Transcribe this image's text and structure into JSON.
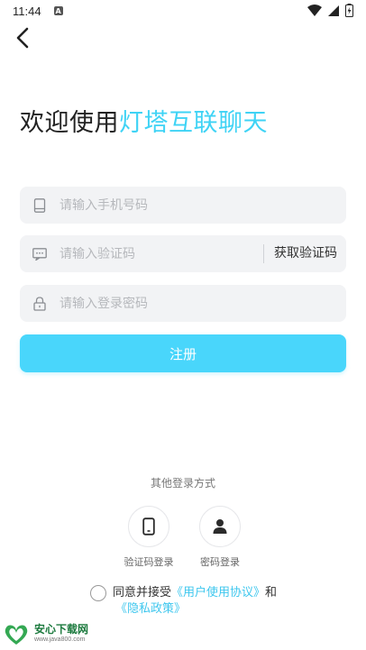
{
  "status_bar": {
    "time": "11:44",
    "notification_badge": "A"
  },
  "header": {
    "back_icon": "chevron-left-icon"
  },
  "welcome": {
    "prefix": "欢迎使用",
    "app_name": "灯塔互联聊天",
    "accent_color": "#3fd3f5"
  },
  "form": {
    "phone": {
      "placeholder": "请输入手机号码",
      "icon": "phone-icon"
    },
    "code": {
      "placeholder": "请输入验证码",
      "icon": "message-icon",
      "button_label": "获取验证码"
    },
    "password": {
      "placeholder": "请输入登录密码",
      "icon": "lock-icon"
    },
    "submit_label": "注册",
    "submit_color": "#49d6fb"
  },
  "other_login": {
    "title": "其他登录方式",
    "methods": [
      {
        "label": "验证码登录",
        "icon": "mobile-icon"
      },
      {
        "label": "密码登录",
        "icon": "user-icon"
      }
    ]
  },
  "agreement": {
    "prefix": "同意并接受",
    "user_agreement": "《用户使用协议》",
    "and": "和",
    "privacy_policy": "《隐私政策》",
    "link_color": "#3fc7ee"
  },
  "watermark": {
    "name": "安心下载网",
    "url": "www.java800.com"
  }
}
